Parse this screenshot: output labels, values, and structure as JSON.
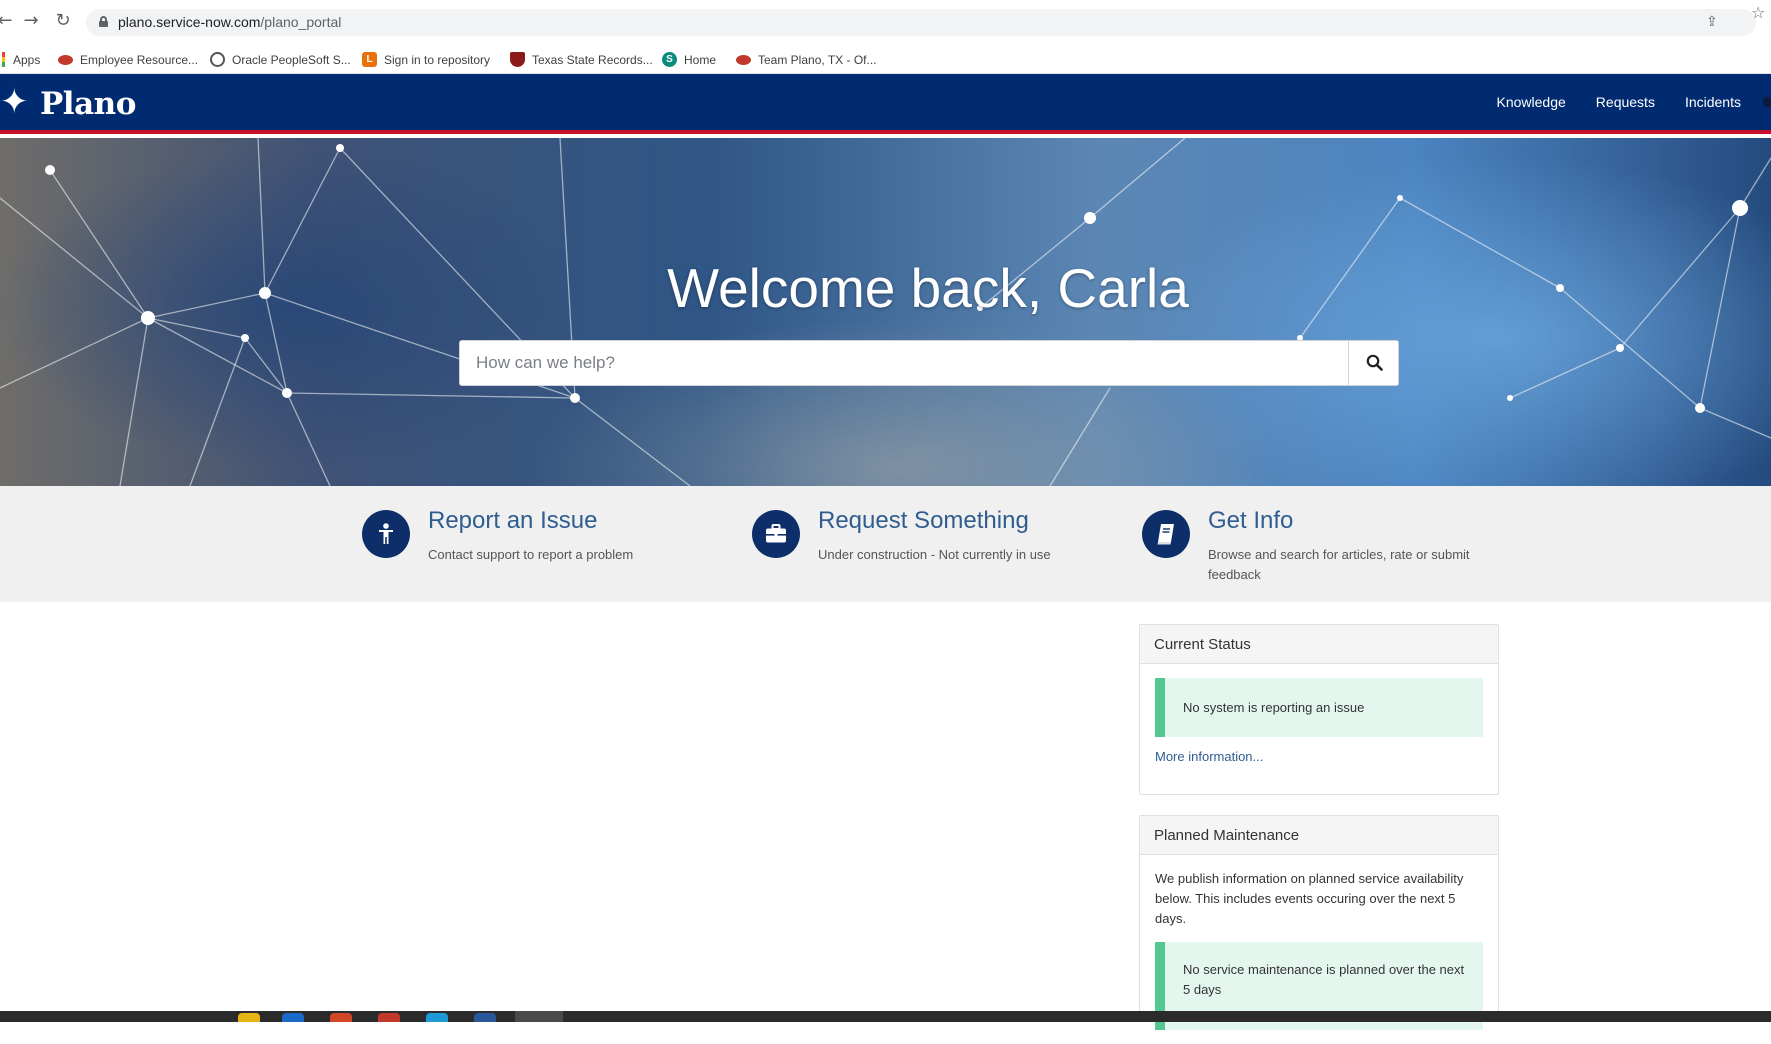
{
  "browser": {
    "url_host": "plano.service-now.com",
    "url_path": "/plano_portal",
    "bookmarks": [
      {
        "label": "Apps",
        "icon": "apps-grid-icon"
      },
      {
        "label": "Employee Resource...",
        "icon": "cp-logo-icon"
      },
      {
        "label": "Oracle PeopleSoft S...",
        "icon": "globe-icon"
      },
      {
        "label": "Sign in to repository",
        "icon": "l-logo-icon"
      },
      {
        "label": "Texas State Records...",
        "icon": "tsl-logo-icon"
      },
      {
        "label": "Home",
        "icon": "sharepoint-icon"
      },
      {
        "label": "Team Plano, TX - Of...",
        "icon": "cp-logo-icon"
      }
    ]
  },
  "header": {
    "logo_text": "Plano",
    "nav": [
      "Knowledge",
      "Requests",
      "Incidents"
    ],
    "colors": {
      "bar": "#002b71",
      "accent_line": "#c8102e"
    }
  },
  "hero": {
    "title": "Welcome back, Carla",
    "search_placeholder": "How can we help?"
  },
  "quick_links": [
    {
      "title": "Report an Issue",
      "description": "Contact support to report a problem",
      "icon": "person-icon"
    },
    {
      "title": "Request Something",
      "description": "Under construction - Not currently in use",
      "icon": "briefcase-icon"
    },
    {
      "title": "Get Info",
      "description": "Browse and search for articles, rate or submit feedback",
      "icon": "book-icon"
    }
  ],
  "current_status": {
    "heading": "Current Status",
    "message": "No system is reporting an issue",
    "link": "More information...",
    "color": "#55c791"
  },
  "planned_maintenance": {
    "heading": "Planned Maintenance",
    "intro": "We publish information on planned service availability below. This includes events occuring over the next 5 days.",
    "message": "No service maintenance is planned over the next 5 days"
  }
}
